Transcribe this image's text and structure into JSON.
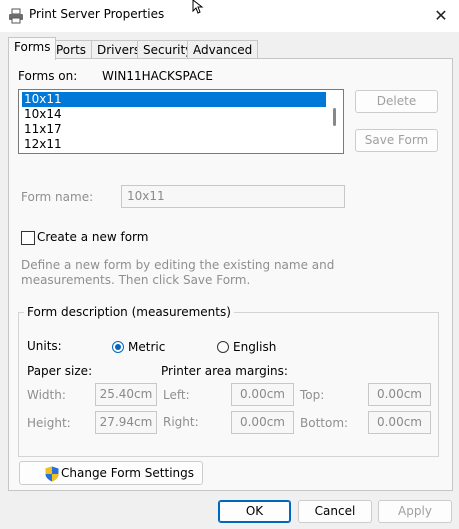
{
  "window": {
    "title": "Print Server Properties",
    "close_glyph": "✕"
  },
  "tabs": [
    {
      "label": "Forms",
      "active": true
    },
    {
      "label": "Ports",
      "active": false
    },
    {
      "label": "Drivers",
      "active": false
    },
    {
      "label": "Security",
      "active": false
    },
    {
      "label": "Advanced",
      "active": false
    }
  ],
  "forms": {
    "forms_on_label": "Forms on:",
    "server_name": "WIN11HACKSPACE",
    "list": [
      "10x11",
      "10x14",
      "11x17",
      "12x11"
    ],
    "selected": "10x11",
    "delete_button": "Delete",
    "save_form_button": "Save Form",
    "form_name_label": "Form name:",
    "form_name_value": "10x11",
    "create_new_form_label": "Create a new form",
    "create_new_form_checked": false,
    "help_text_line1": "Define a new form by editing the existing name and",
    "help_text_line2": "measurements. Then click Save Form."
  },
  "description": {
    "group_title": "Form description (measurements)",
    "units_label": "Units:",
    "metric_label": "Metric",
    "english_label": "English",
    "selected_unit": "Metric",
    "paper_size_label": "Paper size:",
    "printer_margins_label": "Printer area margins:",
    "width_label": "Width:",
    "width_value": "25.40cm",
    "height_label": "Height:",
    "height_value": "27.94cm",
    "left_label": "Left:",
    "left_value": "0.00cm",
    "right_label": "Right:",
    "right_value": "0.00cm",
    "top_label": "Top:",
    "top_value": "0.00cm",
    "bottom_label": "Bottom:",
    "bottom_value": "0.00cm"
  },
  "change_form_settings_button": "Change Form Settings",
  "footer": {
    "ok": "OK",
    "cancel": "Cancel",
    "apply": "Apply"
  },
  "colors": {
    "accent": "#0067c0",
    "selection": "#0078d7",
    "shield_yellow": "#f2c01e",
    "shield_blue": "#2a6fd6"
  }
}
